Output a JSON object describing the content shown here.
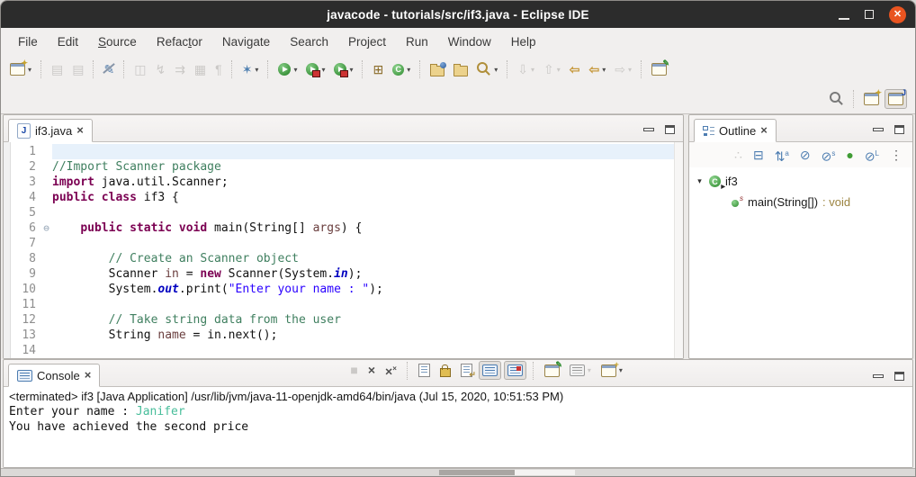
{
  "window": {
    "title": "javacode - tutorials/src/if3.java - Eclipse IDE",
    "controls": [
      {
        "name": "minimize-window",
        "icon": "minimize-icon"
      },
      {
        "name": "maximize-window",
        "icon": "maximize-icon"
      },
      {
        "name": "close-window",
        "icon": "close-icon",
        "glyph": "✕",
        "color": "#e95420"
      }
    ]
  },
  "menubar": {
    "items": [
      {
        "label": "File"
      },
      {
        "label": "Edit"
      },
      {
        "label": "Source",
        "underline": 0
      },
      {
        "label": "Refactor",
        "underline": 5
      },
      {
        "label": "Navigate"
      },
      {
        "label": "Search"
      },
      {
        "label": "Project"
      },
      {
        "label": "Run"
      },
      {
        "label": "Window"
      },
      {
        "label": "Help"
      }
    ]
  },
  "toolbar": {
    "groups": [
      [
        {
          "name": "new-wizard",
          "kind": "win",
          "deco": "✦",
          "dd": true
        }
      ],
      [
        {
          "name": "save",
          "kind": "glyph",
          "glyph": "▤",
          "disabled": true
        },
        {
          "name": "save-all",
          "kind": "glyph",
          "glyph": "▤",
          "disabled": true
        }
      ],
      [
        {
          "name": "toggle-mark-occurrences",
          "kind": "glyph",
          "glyph": "✎",
          "color": "#5b82ad",
          "slash": true
        }
      ],
      [
        {
          "name": "build-all",
          "kind": "glyph",
          "glyph": "◫",
          "disabled": true
        },
        {
          "name": "run-last-tool",
          "kind": "glyph",
          "glyph": "↯",
          "disabled": true
        },
        {
          "name": "apply-patch",
          "kind": "glyph",
          "glyph": "⇉",
          "disabled": true
        },
        {
          "name": "toggle-table",
          "kind": "glyph",
          "glyph": "▦",
          "disabled": true
        },
        {
          "name": "show-whitespace",
          "kind": "glyph",
          "glyph": "¶",
          "disabled": true
        }
      ],
      [
        {
          "name": "debug",
          "kind": "glyph",
          "glyph": "✶",
          "color": "#4e7fb0",
          "dd": true
        }
      ],
      [
        {
          "name": "run",
          "kind": "run",
          "dd": true
        },
        {
          "name": "coverage",
          "kind": "run",
          "chip": true,
          "dd": true
        },
        {
          "name": "profile",
          "kind": "run",
          "chip": true,
          "dd": true
        }
      ],
      [
        {
          "name": "new-java-project",
          "kind": "glyph",
          "glyph": "⊞",
          "color": "#8a6b28"
        },
        {
          "name": "new-java-class",
          "kind": "class",
          "dd": true
        }
      ],
      [
        {
          "name": "open-type",
          "kind": "folder",
          "dot": true
        },
        {
          "name": "open-resource",
          "kind": "folder"
        },
        {
          "name": "search-torch",
          "kind": "mag",
          "color": "#b08f3a",
          "dd": true
        }
      ],
      [
        {
          "name": "next-annotation",
          "kind": "glyph",
          "glyph": "⇩",
          "disabled": true,
          "dd": true
        },
        {
          "name": "previous-annotation",
          "kind": "glyph",
          "glyph": "⇧",
          "disabled": true,
          "dd": true
        },
        {
          "name": "last-edit-location",
          "kind": "glyph",
          "glyph": "⇦",
          "color": "#c79a3e",
          "bold": true
        },
        {
          "name": "back-history",
          "kind": "glyph",
          "glyph": "⇦",
          "color": "#c79a3e",
          "bold": true,
          "dd": true
        },
        {
          "name": "forward-history",
          "kind": "glyph",
          "glyph": "⇨",
          "disabled": true,
          "dd": true
        }
      ],
      [
        {
          "name": "link-with-editor",
          "kind": "win",
          "deco": "✎",
          "decoColor": "#2e8b2e"
        }
      ]
    ],
    "right": [
      [
        {
          "name": "quick-search",
          "kind": "mag",
          "color": "#7a7a7a"
        }
      ],
      [
        {
          "name": "open-perspective",
          "kind": "win",
          "deco": "✦"
        },
        {
          "name": "java-perspective",
          "kind": "win",
          "deco": "J",
          "decoColor": "#1b48a8",
          "active": true
        }
      ]
    ]
  },
  "editor": {
    "tab_label": "if3.java",
    "file_icon": "J",
    "lines": [
      {
        "n": 1,
        "hl": true,
        "segs": []
      },
      {
        "n": 2,
        "segs": [
          {
            "c": "c",
            "t": "//Import Scanner package"
          }
        ]
      },
      {
        "n": 3,
        "segs": [
          {
            "c": "k",
            "t": "import"
          },
          {
            "c": "p",
            "t": " java.util.Scanner;"
          }
        ]
      },
      {
        "n": 4,
        "segs": [
          {
            "c": "k",
            "t": "public class"
          },
          {
            "c": "p",
            "t": " if3 {"
          }
        ]
      },
      {
        "n": 5,
        "segs": []
      },
      {
        "n": 6,
        "fold": true,
        "segs": [
          {
            "c": "p",
            "t": "    "
          },
          {
            "c": "k",
            "t": "public static void"
          },
          {
            "c": "p",
            "t": " main(String[] "
          },
          {
            "c": "v",
            "t": "args"
          },
          {
            "c": "p",
            "t": ") {"
          }
        ]
      },
      {
        "n": 7,
        "segs": []
      },
      {
        "n": 8,
        "segs": [
          {
            "c": "p",
            "t": "        "
          },
          {
            "c": "c",
            "t": "// Create an Scanner object"
          }
        ]
      },
      {
        "n": 9,
        "segs": [
          {
            "c": "p",
            "t": "        Scanner "
          },
          {
            "c": "v",
            "t": "in"
          },
          {
            "c": "p",
            "t": " = "
          },
          {
            "c": "k",
            "t": "new"
          },
          {
            "c": "p",
            "t": " Scanner(System."
          },
          {
            "c": "f",
            "t": "in"
          },
          {
            "c": "p",
            "t": ");"
          }
        ]
      },
      {
        "n": 10,
        "segs": [
          {
            "c": "p",
            "t": "        System."
          },
          {
            "c": "f",
            "t": "out"
          },
          {
            "c": "p",
            "t": ".print("
          },
          {
            "c": "s",
            "t": "\"Enter your name : \""
          },
          {
            "c": "p",
            "t": ");"
          }
        ]
      },
      {
        "n": 11,
        "segs": []
      },
      {
        "n": 12,
        "segs": [
          {
            "c": "p",
            "t": "        "
          },
          {
            "c": "c",
            "t": "// Take string data from the user"
          }
        ]
      },
      {
        "n": 13,
        "segs": [
          {
            "c": "p",
            "t": "        String "
          },
          {
            "c": "v",
            "t": "name"
          },
          {
            "c": "p",
            "t": " = in.next();"
          }
        ]
      },
      {
        "n": 14,
        "segs": []
      }
    ]
  },
  "outline": {
    "tab_label": "Outline",
    "toolbar": [
      {
        "name": "focus-on-active-task",
        "kind": "glyph",
        "glyph": "∴",
        "disabled": true
      },
      {
        "name": "collapse-all",
        "kind": "glyph",
        "glyph": "⊟",
        "color": "#4d7db1"
      },
      {
        "name": "sort-alphabetically",
        "kind": "glyph",
        "glyph": "⇅",
        "sup": "a",
        "color": "#4d7db1"
      },
      {
        "name": "hide-fields",
        "kind": "glyph",
        "glyph": "⊘",
        "color": "#4d7db1"
      },
      {
        "name": "hide-static-members",
        "kind": "glyph",
        "glyph": "⊘",
        "sup": "s",
        "color": "#4d7db1"
      },
      {
        "name": "hide-non-public-members",
        "kind": "glyph",
        "glyph": "●",
        "color": "#3f9c35"
      },
      {
        "name": "hide-local-types",
        "kind": "glyph",
        "glyph": "⊘",
        "sup": "L",
        "color": "#4d7db1"
      },
      {
        "name": "view-menu",
        "kind": "glyph",
        "glyph": "⋮",
        "color": "#555555"
      }
    ],
    "tree": [
      {
        "name": "class-if3",
        "level": 0,
        "expander": "▾",
        "icon": "class",
        "rdeco": true,
        "label": "if3"
      },
      {
        "name": "method-main",
        "level": 1,
        "icon": "method",
        "static_deco": "s",
        "label": "main(String[])",
        "suffix": " : void"
      }
    ]
  },
  "console": {
    "tab_label": "Console",
    "status": "<terminated> if3 [Java Application] /usr/lib/jvm/java-11-openjdk-amd64/bin/java (Jul 15, 2020, 10:51:53 PM)",
    "lines": [
      [
        {
          "t": "Enter your name : "
        },
        {
          "t": "Janifer",
          "c": "input"
        }
      ],
      [
        {
          "t": "You have achieved the second price"
        }
      ]
    ],
    "toolbar": [
      [
        {
          "name": "terminate",
          "kind": "glyph",
          "glyph": "■",
          "disabled": true
        },
        {
          "name": "remove-launch",
          "kind": "glyph",
          "glyph": "×",
          "color": "#4f4f4f",
          "bold": true
        },
        {
          "name": "remove-all-terminated",
          "kind": "glyph",
          "glyph": "×",
          "sup": "×",
          "color": "#4f4f4f",
          "bold": true
        }
      ],
      [
        {
          "name": "clear-console",
          "kind": "page"
        },
        {
          "name": "scroll-lock",
          "kind": "lock"
        },
        {
          "name": "word-wrap",
          "kind": "page",
          "deco": "↵"
        },
        {
          "name": "pin-console",
          "kind": "chat",
          "active": true
        },
        {
          "name": "show-on-stdout-change",
          "kind": "chat",
          "red": true,
          "active": true
        }
      ],
      [
        {
          "name": "open-console-pinned",
          "kind": "win",
          "deco": "✎",
          "decoColor": "#2e8b2e"
        },
        {
          "name": "display-selected-console",
          "kind": "chat",
          "gray": true,
          "dd": true,
          "dddis": true
        },
        {
          "name": "open-console",
          "kind": "win",
          "deco": "+",
          "dd": true
        }
      ]
    ]
  },
  "colors": {
    "titlebar_bg": "#2c2c2c",
    "close_button": "#e95420",
    "current_line_highlight": "#e7f1fb",
    "comment": "#3f7f5f",
    "keyword": "#7b0052",
    "string": "#2a00ff",
    "static_field": "#0000c0",
    "local_variable": "#6a3e3e",
    "console_input": "#47bd9a",
    "outline_return_type": "#9c8440"
  }
}
